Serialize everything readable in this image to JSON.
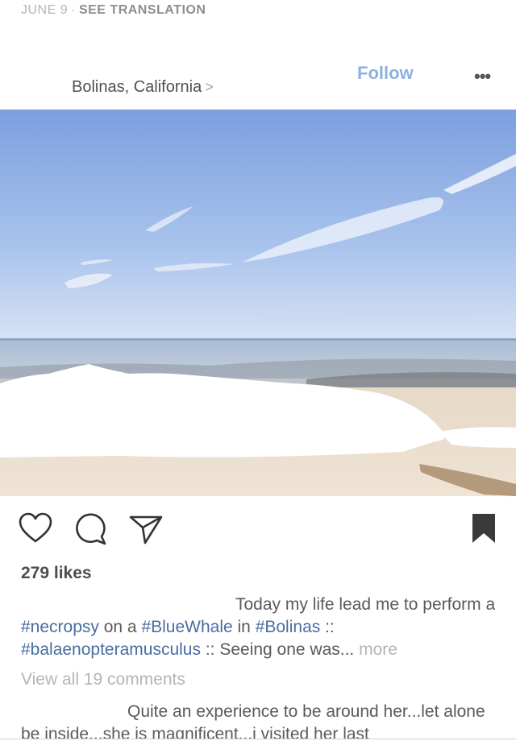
{
  "topline": {
    "date": "JUNE 9",
    "separator": "·",
    "translation": "SEE TRANSLATION"
  },
  "header": {
    "location": "Bolinas, California",
    "location_chevron": ">",
    "follow_label": "Follow",
    "more_label": "•••"
  },
  "photo": {
    "description_icon": "beach-photo"
  },
  "actions": {
    "like_icon": "heart-icon",
    "comment_icon": "comment-icon",
    "share_icon": "share-icon",
    "save_icon": "bookmark-icon"
  },
  "likes": "279 likes",
  "caption": {
    "text1": "Today my life lead me to perform a ",
    "tag1": "#necropsy",
    "text2": " on a ",
    "tag2": "#BlueWhale",
    "text3": " in ",
    "tag3": "#Bolinas",
    "text4": " :: ",
    "tag4": "#balaenopteramusculus",
    "text5": " :: Seeing one was...",
    "more": " more"
  },
  "view_all_comments": "View all 19 comments",
  "comment": {
    "text": "Quite an experience to be around her...let alone be inside...she is magnificent...i visited her last"
  },
  "colors": {
    "link_blue": "#4a6da0",
    "follow_blue": "#8fb1df",
    "muted": "#b5b5b5"
  }
}
